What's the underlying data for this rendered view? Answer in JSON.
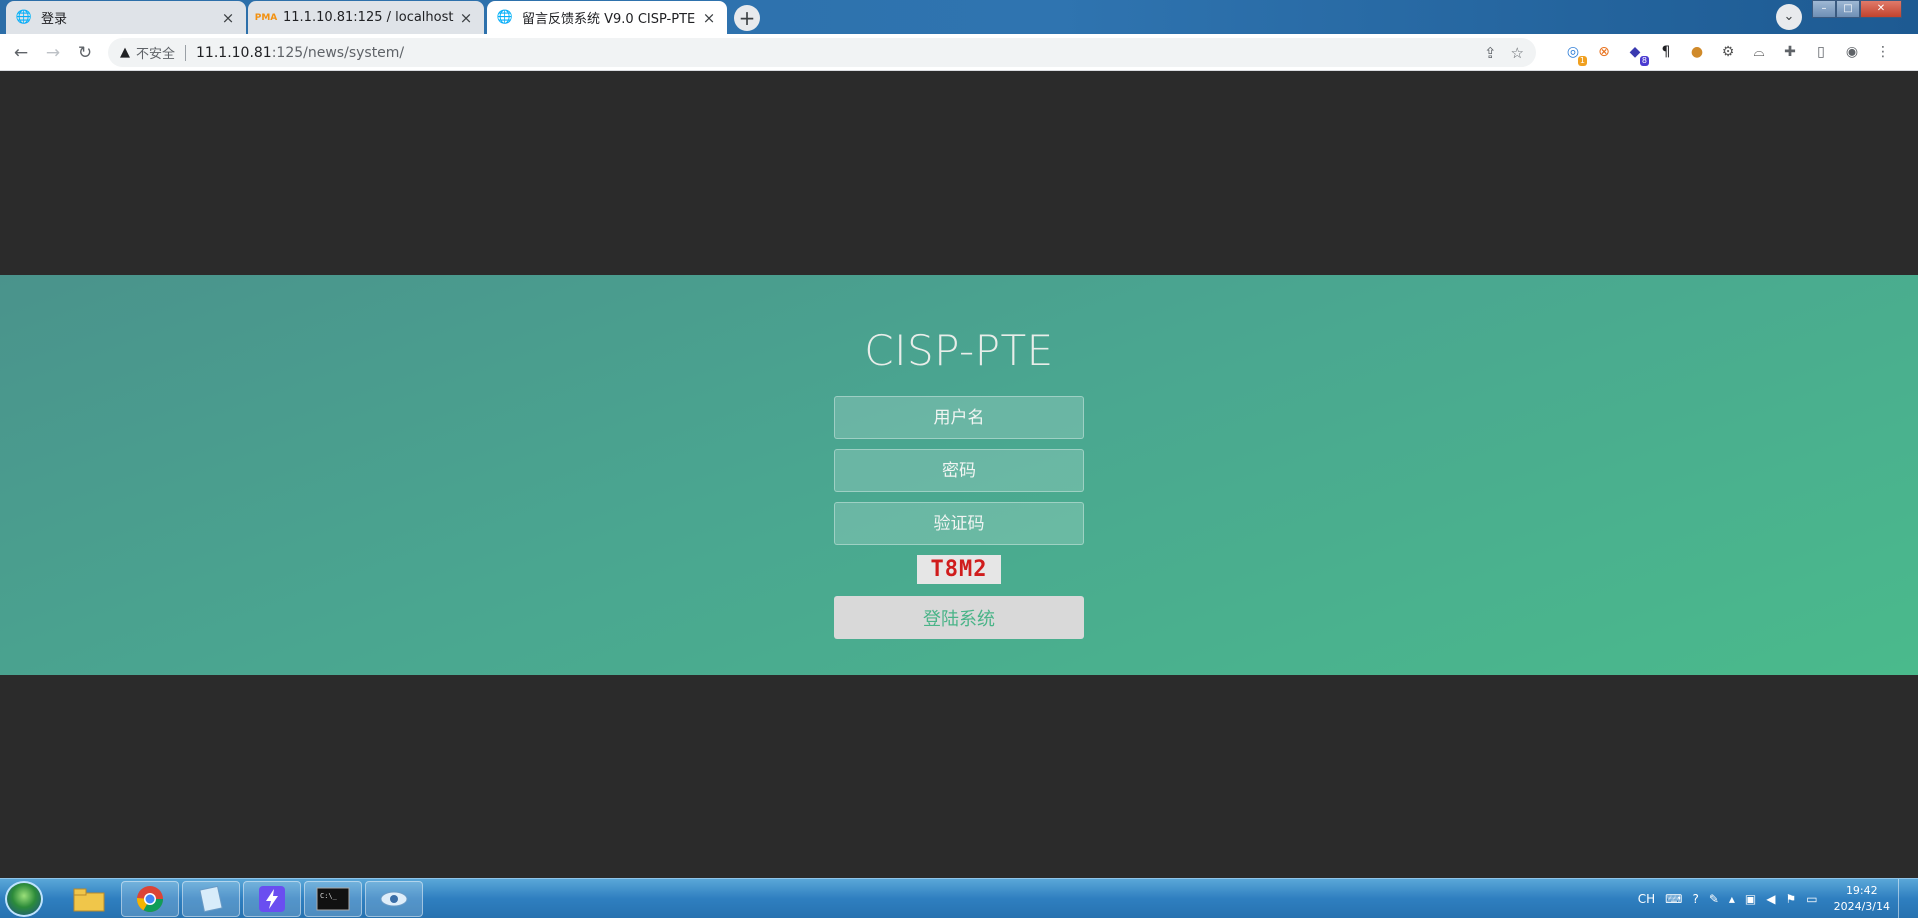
{
  "browser": {
    "tabs": [
      {
        "label": "登录",
        "icon": "globe-icon",
        "active": false
      },
      {
        "label": "11.1.10.81:125 / localhost | ph",
        "icon": "phpmyadmin-icon",
        "active": false
      },
      {
        "label": "留言反馈系统 V9.0 CISP-PTE",
        "icon": "globe-icon",
        "active": true
      }
    ],
    "new_tab": "+",
    "security_label": "不安全",
    "url_host": "11.1.10.81",
    "url_path": ":125/news/system/"
  },
  "login": {
    "brand": "CISP-PTE",
    "username_placeholder": "用户名",
    "password_placeholder": "密码",
    "captcha_placeholder": "验证码",
    "captcha_code": "T8M2",
    "submit_label": "登陆系统"
  },
  "colors": {
    "page_bg": "#2b2b2b",
    "band_start": "#4a938c",
    "band_end": "#4aba8c",
    "captcha_text": "#d01c1c",
    "button_text": "#4ab488"
  },
  "taskbar": {
    "lang": "CH",
    "time": "19:42",
    "date": "2024/3/14"
  }
}
